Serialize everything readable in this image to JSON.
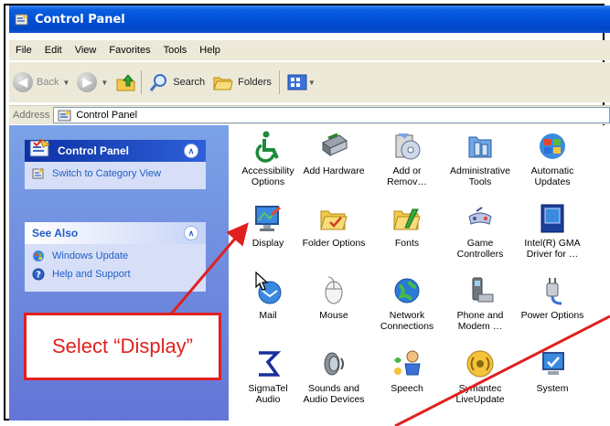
{
  "window": {
    "title": "Control Panel"
  },
  "menu": [
    "File",
    "Edit",
    "View",
    "Favorites",
    "Tools",
    "Help"
  ],
  "toolbar": {
    "back": "Back",
    "search": "Search",
    "folders": "Folders"
  },
  "address": {
    "label": "Address",
    "value": "Control Panel"
  },
  "sidebar": {
    "control_panel": {
      "title": "Control Panel",
      "link": "Switch to Category View"
    },
    "see_also": {
      "title": "See Also",
      "links": [
        "Windows Update",
        "Help and Support"
      ]
    }
  },
  "items": [
    [
      "Accessibility",
      "Options"
    ],
    [
      "Add Hardware",
      ""
    ],
    [
      "Add or",
      "Remov…"
    ],
    [
      "Administrative",
      "Tools"
    ],
    [
      "Automatic",
      "Updates"
    ],
    [
      "Display",
      ""
    ],
    [
      "Folder Options",
      ""
    ],
    [
      "Fonts",
      ""
    ],
    [
      "Game",
      "Controllers"
    ],
    [
      "Intel(R) GMA",
      "Driver for …"
    ],
    [
      "Mail",
      ""
    ],
    [
      "Mouse",
      ""
    ],
    [
      "Network",
      "Connections"
    ],
    [
      "Phone and",
      "Modem …"
    ],
    [
      "Power Options",
      ""
    ],
    [
      "SigmaTel",
      "Audio"
    ],
    [
      "Sounds and",
      "Audio Devices"
    ],
    [
      "Speech",
      ""
    ],
    [
      "Symantec",
      "LiveUpdate"
    ],
    [
      "System",
      ""
    ]
  ],
  "annotation": {
    "callout": "Select “Display”"
  },
  "colors": {
    "title_bar": "#0050d8",
    "sidebar": "#7ba2e7",
    "callout": "#e02020"
  }
}
